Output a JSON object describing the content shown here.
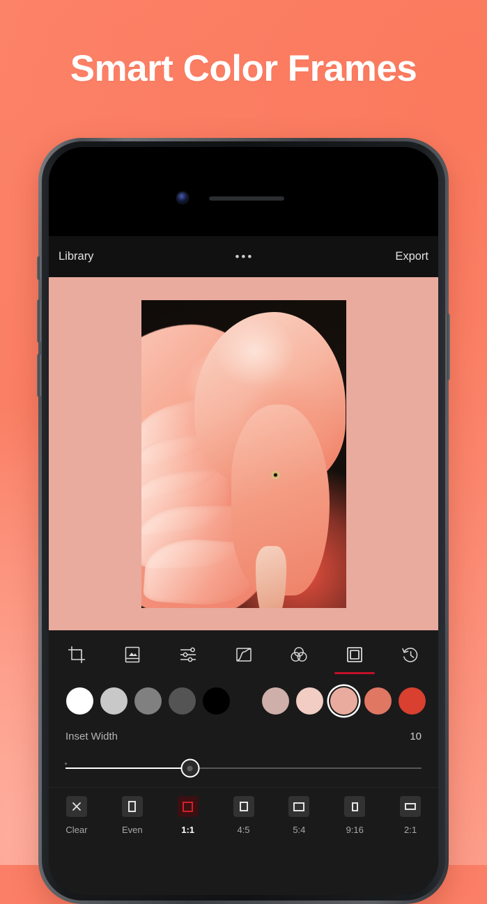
{
  "promo": {
    "headline": "Smart Color Frames",
    "background_color": "#fc8268"
  },
  "app": {
    "topbar": {
      "library_label": "Library",
      "more_label": "•••",
      "export_label": "Export"
    },
    "canvas": {
      "frame_color": "#e8ab9e",
      "photo_subject": "flamingo"
    },
    "tools": [
      {
        "name": "crop-tool",
        "icon": "crop-icon",
        "selected": false
      },
      {
        "name": "frame-photo-tool",
        "icon": "photo-frame-icon",
        "selected": false
      },
      {
        "name": "adjust-tool",
        "icon": "sliders-icon",
        "selected": false
      },
      {
        "name": "curves-tool",
        "icon": "curves-icon",
        "selected": false
      },
      {
        "name": "color-mix-tool",
        "icon": "color-circles-icon",
        "selected": false
      },
      {
        "name": "frames-tool",
        "icon": "frame-square-icon",
        "selected": true
      },
      {
        "name": "history-tool",
        "icon": "history-clock-icon",
        "selected": false
      }
    ],
    "palette": {
      "accent_color": "#c0112a",
      "swatches": [
        {
          "name": "swatch-white",
          "color": "#ffffff",
          "selected": false
        },
        {
          "name": "swatch-light-gray",
          "color": "#c8c8c8",
          "selected": false
        },
        {
          "name": "swatch-mid-gray",
          "color": "#808080",
          "selected": false
        },
        {
          "name": "swatch-dark-gray",
          "color": "#545454",
          "selected": false
        },
        {
          "name": "swatch-black",
          "color": "#000000",
          "selected": false
        }
      ],
      "color_swatches": [
        {
          "name": "swatch-dusty-rose",
          "color": "#ceafa9",
          "selected": false
        },
        {
          "name": "swatch-pale-pink",
          "color": "#f2cdc4",
          "selected": false
        },
        {
          "name": "swatch-salmon-pink",
          "color": "#e8ab9e",
          "selected": true
        },
        {
          "name": "swatch-coral",
          "color": "#e07762",
          "selected": false
        },
        {
          "name": "swatch-red",
          "color": "#d9402f",
          "selected": false
        }
      ]
    },
    "inset": {
      "label": "Inset Width",
      "value": "10",
      "slider_percent": 35
    },
    "ratios": [
      {
        "name": "ratio-clear",
        "label": "Clear",
        "icon": "close-x-icon",
        "w": 11,
        "h": 15,
        "selected": false
      },
      {
        "name": "ratio-even",
        "label": "Even",
        "icon": "rect-even-icon",
        "w": 11,
        "h": 16,
        "selected": false
      },
      {
        "name": "ratio-1-1",
        "label": "1:1",
        "icon": "rect-1-1-icon",
        "w": 15,
        "h": 15,
        "selected": true
      },
      {
        "name": "ratio-4-5",
        "label": "4:5",
        "icon": "rect-4-5-icon",
        "w": 12,
        "h": 14,
        "selected": false
      },
      {
        "name": "ratio-5-4",
        "label": "5:4",
        "icon": "rect-5-4-icon",
        "w": 16,
        "h": 13,
        "selected": false
      },
      {
        "name": "ratio-9-16",
        "label": "9:16",
        "icon": "rect-9-16-icon",
        "w": 9,
        "h": 13,
        "selected": false
      },
      {
        "name": "ratio-2-1",
        "label": "2:1",
        "icon": "rect-2-1-icon",
        "w": 16,
        "h": 10,
        "selected": false
      }
    ]
  }
}
